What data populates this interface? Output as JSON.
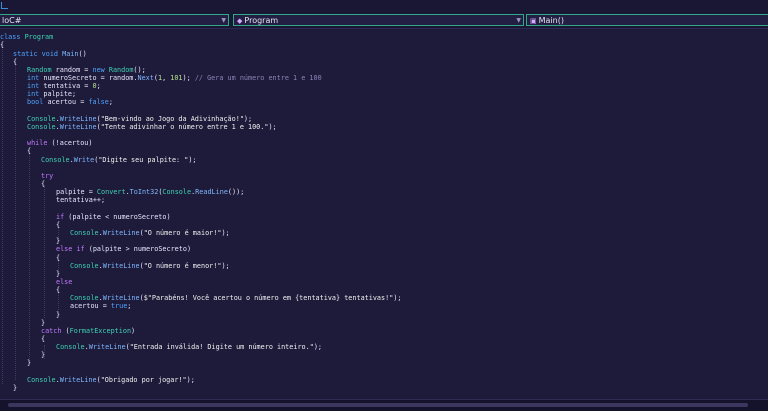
{
  "nav": {
    "project": "loC#",
    "class_name": "Program",
    "member": "Main()",
    "class_icon": "class-icon",
    "member_icon": "method-icon"
  },
  "code": {
    "l1_kw": "class",
    "l1_name": "Program",
    "l2": "{",
    "l3_kw": "static void",
    "l3_mth": "Main",
    "l3_rest": "()",
    "l4": "{",
    "l5_a": "Random",
    "l5_b": " random = ",
    "l5_c": "new",
    "l5_d": " ",
    "l5_e": "Random",
    "l5_f": "();",
    "l6_a": "int",
    "l6_b": " numeroSecreto = random.",
    "l6_c": "Next",
    "l6_d": "(",
    "l6_e": "1",
    "l6_f": ", ",
    "l6_g": "101",
    "l6_h": "); ",
    "l6_cmt": "// Gera um número entre 1 e 100",
    "l7_a": "int",
    "l7_b": " tentativa = ",
    "l7_c": "0",
    "l7_d": ";",
    "l8_a": "int",
    "l8_b": " palpite;",
    "l9_a": "bool",
    "l9_b": " acertou = ",
    "l9_c": "false",
    "l9_d": ";",
    "l11_a": "Console",
    "l11_b": ".",
    "l11_c": "WriteLine",
    "l11_d": "(",
    "l11_e": "\"Bem-vindo ao Jogo da Adivinhação!\"",
    "l11_f": ");",
    "l12_a": "Console",
    "l12_b": ".",
    "l12_c": "WriteLine",
    "l12_d": "(",
    "l12_e": "\"Tente adivinhar o número entre 1 e 100.\"",
    "l12_f": ");",
    "l14_a": "while",
    "l14_b": " (!acertou)",
    "l15": "{",
    "l16_a": "Console",
    "l16_b": ".",
    "l16_c": "Write",
    "l16_d": "(",
    "l16_e": "\"Digite seu palpite: \"",
    "l16_f": ");",
    "l18_a": "try",
    "l19": "{",
    "l20_a": "palpite = ",
    "l20_b": "Convert",
    "l20_c": ".",
    "l20_d": "ToInt32",
    "l20_e": "(",
    "l20_f": "Console",
    "l20_g": ".",
    "l20_h": "ReadLine",
    "l20_i": "());",
    "l21": "tentativa++;",
    "l23_a": "if",
    "l23_b": " (palpite < numeroSecreto)",
    "l24": "{",
    "l25_a": "Console",
    "l25_b": ".",
    "l25_c": "WriteLine",
    "l25_d": "(",
    "l25_e": "\"O número é maior!\"",
    "l25_f": ");",
    "l26": "}",
    "l27_a": "else if",
    "l27_b": " (palpite > numeroSecreto)",
    "l28": "{",
    "l29_a": "Console",
    "l29_b": ".",
    "l29_c": "WriteLine",
    "l29_d": "(",
    "l29_e": "\"O número é menor!\"",
    "l29_f": ");",
    "l30": "}",
    "l31": "else",
    "l32": "{",
    "l33_a": "Console",
    "l33_b": ".",
    "l33_c": "WriteLine",
    "l33_d": "(",
    "l33_e": "$\"Parabéns! Você acertou o número em {tentativa} tentativas!\"",
    "l33_f": ");",
    "l34_a": "acertou = ",
    "l34_b": "true",
    "l34_c": ";",
    "l35": "}",
    "l36": "}",
    "l37_a": "catch",
    "l37_b": " (",
    "l37_c": "FormatException",
    "l37_d": ")",
    "l38": "{",
    "l39_a": "Console",
    "l39_b": ".",
    "l39_c": "WriteLine",
    "l39_d": "(",
    "l39_e": "\"Entrada inválida! Digite um número inteiro.\"",
    "l39_f": ");",
    "l40": "}",
    "l41": "}",
    "l43_a": "Console",
    "l43_b": ".",
    "l43_c": "WriteLine",
    "l43_d": "(",
    "l43_e": "\"Obrigado por jogar!\"",
    "l43_f": ");",
    "l44": "}"
  }
}
